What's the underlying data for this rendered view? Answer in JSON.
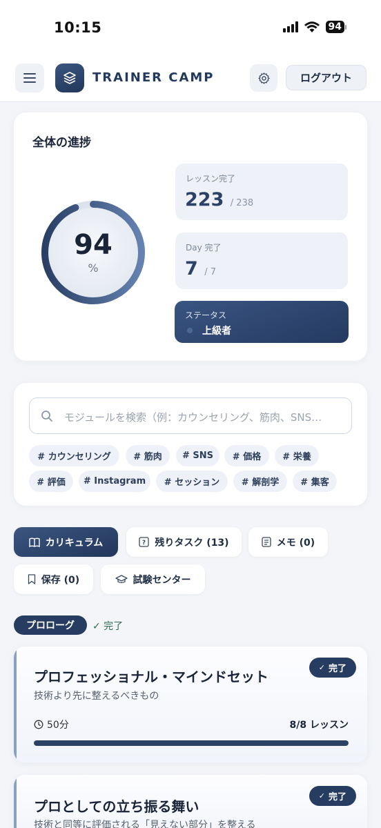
{
  "status_bar": {
    "time": "10:15",
    "battery": "94"
  },
  "header": {
    "brand": "TRAINER CAMP",
    "logout_label": "ログアウト"
  },
  "progress": {
    "title": "全体の進捗",
    "percent": "94",
    "percent_value": 94,
    "percent_unit": "%",
    "lessons": {
      "label": "レッスン完了",
      "value": "223",
      "total": "/ 238"
    },
    "days": {
      "label": "Day 完了",
      "value": "7",
      "total": "/ 7"
    },
    "status": {
      "label": "ステータス",
      "value": "上級者"
    }
  },
  "search": {
    "placeholder": "モジュールを検索（例：カウンセリング、筋肉、SNS…",
    "tags": [
      "# カウンセリング",
      "# 筋肉",
      "# SNS",
      "# 価格",
      "# 栄養",
      "# 評価",
      "# Instagram",
      "# セッション",
      "# 解剖学",
      "# 集客"
    ]
  },
  "tabs": [
    {
      "label": "カリキュラム",
      "icon": "book-icon",
      "active": true
    },
    {
      "label": "残りタスク (13)",
      "icon": "question-icon",
      "active": false
    },
    {
      "label": "メモ (0)",
      "icon": "memo-icon",
      "active": false
    },
    {
      "label": "保存 (0)",
      "icon": "bookmark-icon",
      "active": false
    },
    {
      "label": "試験センター",
      "icon": "graduation-icon",
      "active": false
    }
  ],
  "section": {
    "label": "プロローグ",
    "done": "✓ 完了"
  },
  "modules": [
    {
      "title": "プロフェッショナル・マインドセット",
      "subtitle": "技術より先に整えるべきもの",
      "done": "完了",
      "duration": "50分",
      "lessons": "8/8 レッスン",
      "progress": 1.0
    },
    {
      "title": "プロとしての立ち振る舞い",
      "subtitle": "技術と同等に評価される「見えない部分」を整える",
      "done": "完了",
      "duration": "",
      "lessons": "",
      "progress": 1.0
    }
  ],
  "colors": {
    "navy": "#263c61",
    "accent": "#2c4166",
    "background": "#f3f5f8"
  }
}
